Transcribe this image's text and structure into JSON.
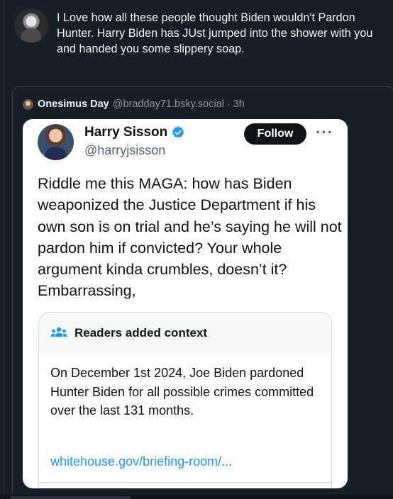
{
  "post": {
    "text": "I Love how all these people thought Biden wouldn't Pardon Hunter. Harry Biden has JUst jumped into the  shower with you and handed you some slippery soap."
  },
  "quote": {
    "author_name": "Onesimus Day",
    "author_handle": "@bradday71.bsky.social",
    "separator": "·",
    "time": "3h"
  },
  "tweet": {
    "name": "Harry Sisson",
    "handle": "@harryjsisson",
    "follow_label": "Follow",
    "more_label": "···",
    "text": "Riddle me this MAGA: how has Biden weaponized the Justice Department if his own son is on trial and he’s saying he will not pardon him if convicted? Your whole argument kinda crumbles, doesn’t it? Embarrassing,",
    "context": {
      "title": "Readers added context",
      "body": "On December 1st 2024, Joe Biden pardoned Hunter Biden for all possible crimes committed over the last 131 months.",
      "link": "whitehouse.gov/briefing-room/..."
    }
  },
  "colors": {
    "background": "#161e27",
    "verified": "#1d9bf0",
    "link": "#1d9bf0"
  }
}
